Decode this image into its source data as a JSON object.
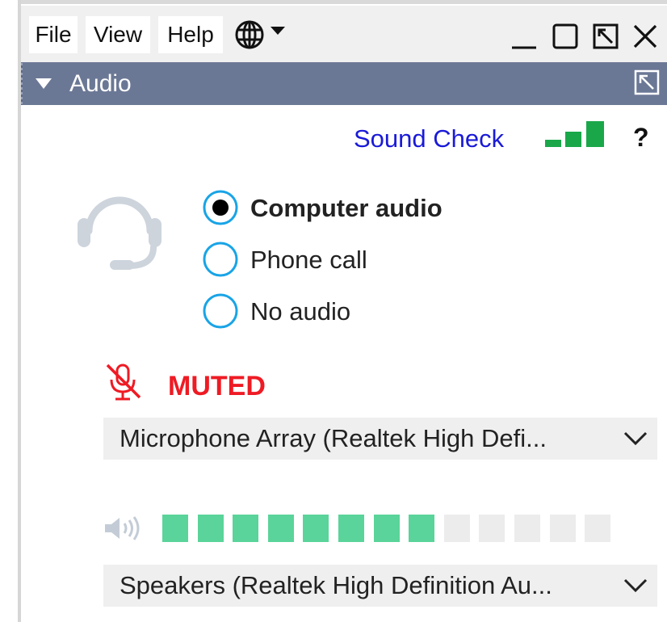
{
  "menubar": {
    "items": [
      {
        "label": "File"
      },
      {
        "label": "View"
      },
      {
        "label": "Help"
      }
    ],
    "language_icon": "globe-icon"
  },
  "window_controls": [
    "minimize-icon",
    "maximize-icon",
    "restore-icon",
    "close-icon"
  ],
  "panel": {
    "title": "Audio",
    "collapse_icon": "triangle-down-icon",
    "undock_icon": "undock-icon"
  },
  "sound_check": {
    "label": "Sound Check",
    "signal_level": 3,
    "signal_max": 3,
    "signal_color": "#1aa74a",
    "help_label": "?"
  },
  "audio_options": {
    "selected": "Computer audio",
    "options": [
      {
        "label": "Computer audio",
        "selected": true
      },
      {
        "label": "Phone call",
        "selected": false
      },
      {
        "label": "No audio",
        "selected": false
      }
    ],
    "radio_color": "#19a4e6"
  },
  "microphone": {
    "status": "MUTED",
    "status_color": "#ee1b24",
    "device": "Microphone Array (Realtek High Defi..."
  },
  "speaker": {
    "level_segments_on": 8,
    "level_segments_total": 13,
    "on_color": "#5ad49a",
    "off_color": "#ececec",
    "device": "Speakers (Realtek High Definition Au..."
  }
}
